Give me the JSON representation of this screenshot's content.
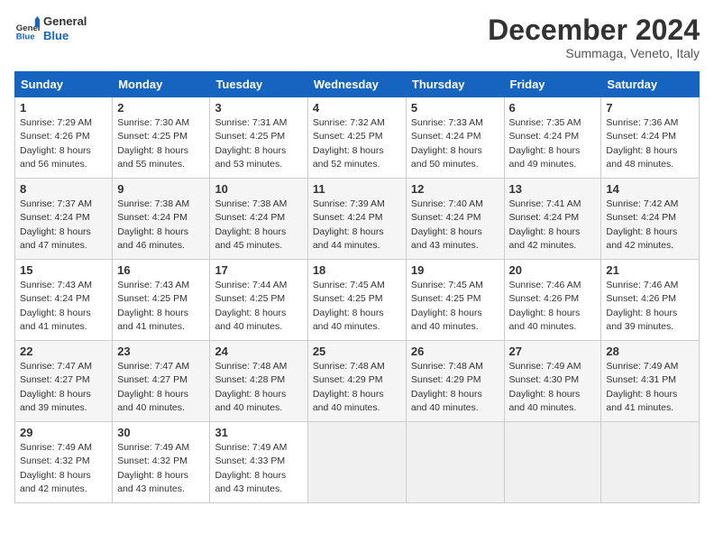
{
  "logo": {
    "line1": "General",
    "line2": "Blue"
  },
  "title": "December 2024",
  "subtitle": "Summaga, Veneto, Italy",
  "weekdays": [
    "Sunday",
    "Monday",
    "Tuesday",
    "Wednesday",
    "Thursday",
    "Friday",
    "Saturday"
  ],
  "weeks": [
    [
      {
        "day": "1",
        "sunrise": "Sunrise: 7:29 AM",
        "sunset": "Sunset: 4:26 PM",
        "daylight": "Daylight: 8 hours and 56 minutes."
      },
      {
        "day": "2",
        "sunrise": "Sunrise: 7:30 AM",
        "sunset": "Sunset: 4:25 PM",
        "daylight": "Daylight: 8 hours and 55 minutes."
      },
      {
        "day": "3",
        "sunrise": "Sunrise: 7:31 AM",
        "sunset": "Sunset: 4:25 PM",
        "daylight": "Daylight: 8 hours and 53 minutes."
      },
      {
        "day": "4",
        "sunrise": "Sunrise: 7:32 AM",
        "sunset": "Sunset: 4:25 PM",
        "daylight": "Daylight: 8 hours and 52 minutes."
      },
      {
        "day": "5",
        "sunrise": "Sunrise: 7:33 AM",
        "sunset": "Sunset: 4:24 PM",
        "daylight": "Daylight: 8 hours and 50 minutes."
      },
      {
        "day": "6",
        "sunrise": "Sunrise: 7:35 AM",
        "sunset": "Sunset: 4:24 PM",
        "daylight": "Daylight: 8 hours and 49 minutes."
      },
      {
        "day": "7",
        "sunrise": "Sunrise: 7:36 AM",
        "sunset": "Sunset: 4:24 PM",
        "daylight": "Daylight: 8 hours and 48 minutes."
      }
    ],
    [
      {
        "day": "8",
        "sunrise": "Sunrise: 7:37 AM",
        "sunset": "Sunset: 4:24 PM",
        "daylight": "Daylight: 8 hours and 47 minutes."
      },
      {
        "day": "9",
        "sunrise": "Sunrise: 7:38 AM",
        "sunset": "Sunset: 4:24 PM",
        "daylight": "Daylight: 8 hours and 46 minutes."
      },
      {
        "day": "10",
        "sunrise": "Sunrise: 7:38 AM",
        "sunset": "Sunset: 4:24 PM",
        "daylight": "Daylight: 8 hours and 45 minutes."
      },
      {
        "day": "11",
        "sunrise": "Sunrise: 7:39 AM",
        "sunset": "Sunset: 4:24 PM",
        "daylight": "Daylight: 8 hours and 44 minutes."
      },
      {
        "day": "12",
        "sunrise": "Sunrise: 7:40 AM",
        "sunset": "Sunset: 4:24 PM",
        "daylight": "Daylight: 8 hours and 43 minutes."
      },
      {
        "day": "13",
        "sunrise": "Sunrise: 7:41 AM",
        "sunset": "Sunset: 4:24 PM",
        "daylight": "Daylight: 8 hours and 42 minutes."
      },
      {
        "day": "14",
        "sunrise": "Sunrise: 7:42 AM",
        "sunset": "Sunset: 4:24 PM",
        "daylight": "Daylight: 8 hours and 42 minutes."
      }
    ],
    [
      {
        "day": "15",
        "sunrise": "Sunrise: 7:43 AM",
        "sunset": "Sunset: 4:24 PM",
        "daylight": "Daylight: 8 hours and 41 minutes."
      },
      {
        "day": "16",
        "sunrise": "Sunrise: 7:43 AM",
        "sunset": "Sunset: 4:25 PM",
        "daylight": "Daylight: 8 hours and 41 minutes."
      },
      {
        "day": "17",
        "sunrise": "Sunrise: 7:44 AM",
        "sunset": "Sunset: 4:25 PM",
        "daylight": "Daylight: 8 hours and 40 minutes."
      },
      {
        "day": "18",
        "sunrise": "Sunrise: 7:45 AM",
        "sunset": "Sunset: 4:25 PM",
        "daylight": "Daylight: 8 hours and 40 minutes."
      },
      {
        "day": "19",
        "sunrise": "Sunrise: 7:45 AM",
        "sunset": "Sunset: 4:25 PM",
        "daylight": "Daylight: 8 hours and 40 minutes."
      },
      {
        "day": "20",
        "sunrise": "Sunrise: 7:46 AM",
        "sunset": "Sunset: 4:26 PM",
        "daylight": "Daylight: 8 hours and 40 minutes."
      },
      {
        "day": "21",
        "sunrise": "Sunrise: 7:46 AM",
        "sunset": "Sunset: 4:26 PM",
        "daylight": "Daylight: 8 hours and 39 minutes."
      }
    ],
    [
      {
        "day": "22",
        "sunrise": "Sunrise: 7:47 AM",
        "sunset": "Sunset: 4:27 PM",
        "daylight": "Daylight: 8 hours and 39 minutes."
      },
      {
        "day": "23",
        "sunrise": "Sunrise: 7:47 AM",
        "sunset": "Sunset: 4:27 PM",
        "daylight": "Daylight: 8 hours and 40 minutes."
      },
      {
        "day": "24",
        "sunrise": "Sunrise: 7:48 AM",
        "sunset": "Sunset: 4:28 PM",
        "daylight": "Daylight: 8 hours and 40 minutes."
      },
      {
        "day": "25",
        "sunrise": "Sunrise: 7:48 AM",
        "sunset": "Sunset: 4:29 PM",
        "daylight": "Daylight: 8 hours and 40 minutes."
      },
      {
        "day": "26",
        "sunrise": "Sunrise: 7:48 AM",
        "sunset": "Sunset: 4:29 PM",
        "daylight": "Daylight: 8 hours and 40 minutes."
      },
      {
        "day": "27",
        "sunrise": "Sunrise: 7:49 AM",
        "sunset": "Sunset: 4:30 PM",
        "daylight": "Daylight: 8 hours and 40 minutes."
      },
      {
        "day": "28",
        "sunrise": "Sunrise: 7:49 AM",
        "sunset": "Sunset: 4:31 PM",
        "daylight": "Daylight: 8 hours and 41 minutes."
      }
    ],
    [
      {
        "day": "29",
        "sunrise": "Sunrise: 7:49 AM",
        "sunset": "Sunset: 4:32 PM",
        "daylight": "Daylight: 8 hours and 42 minutes."
      },
      {
        "day": "30",
        "sunrise": "Sunrise: 7:49 AM",
        "sunset": "Sunset: 4:32 PM",
        "daylight": "Daylight: 8 hours and 43 minutes."
      },
      {
        "day": "31",
        "sunrise": "Sunrise: 7:49 AM",
        "sunset": "Sunset: 4:33 PM",
        "daylight": "Daylight: 8 hours and 43 minutes."
      },
      null,
      null,
      null,
      null
    ]
  ]
}
